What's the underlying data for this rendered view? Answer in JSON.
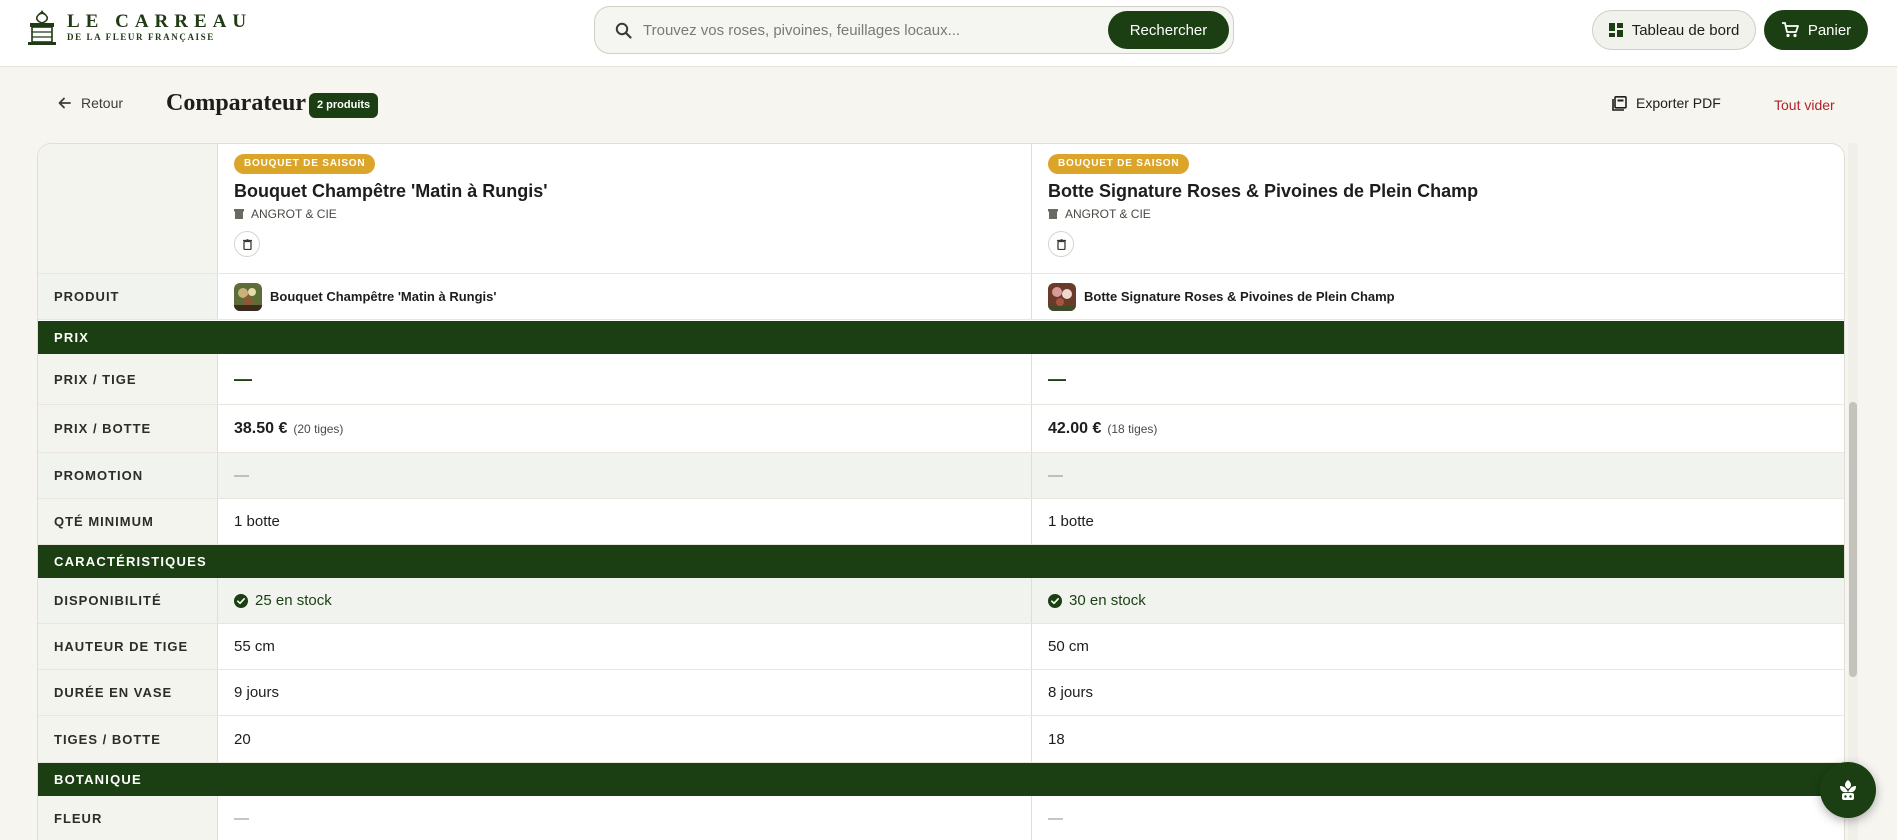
{
  "header": {
    "logo": {
      "line1": "LE CARREAU",
      "line2": "DE LA FLEUR FRANÇAISE",
      "icon": "storefront-logo-icon"
    },
    "search": {
      "placeholder": "Trouvez vos roses, pivoines, feuillages locaux...",
      "value": "",
      "button_label": "Rechercher",
      "icon": "search-icon"
    },
    "dashboard_label": "Tableau de bord",
    "cart_label": "Panier"
  },
  "toolbar": {
    "back_label": "Retour",
    "title": "Comparateur",
    "count_badge": "2 produits",
    "export_label": "Exporter PDF",
    "clear_label": "Tout vider"
  },
  "products": [
    {
      "tag": "BOUQUET DE SAISON",
      "name": "Bouquet Champêtre 'Matin à Rungis'",
      "supplier": "ANGROT & CIE"
    },
    {
      "tag": "BOUQUET DE SAISON",
      "name": "Botte Signature Roses & Pivoines de Plein Champ",
      "supplier": "ANGROT & CIE"
    }
  ],
  "rows": {
    "produit": {
      "label": "PRODUIT"
    },
    "prix_tige": {
      "label": "PRIX / TIGE",
      "values": [
        "—",
        "—"
      ]
    },
    "prix_botte": {
      "label": "PRIX / BOTTE",
      "values": [
        "38.50 €",
        "42.00 €"
      ],
      "notes": [
        "(20 tiges)",
        "(18 tiges)"
      ]
    },
    "promotion": {
      "label": "PROMOTION",
      "values": [
        "—",
        "—"
      ]
    },
    "qte_min": {
      "label": "QTÉ MINIMUM",
      "values": [
        "1 botte",
        "1 botte"
      ]
    },
    "disponibilite": {
      "label": "DISPONIBILITÉ",
      "values": [
        "25 en stock",
        "30 en stock"
      ]
    },
    "hauteur": {
      "label": "HAUTEUR DE TIGE",
      "values": [
        "55 cm",
        "50 cm"
      ]
    },
    "duree": {
      "label": "DURÉE EN VASE",
      "values": [
        "9 jours",
        "8 jours"
      ]
    },
    "tiges": {
      "label": "TIGES / BOTTE",
      "values": [
        "20",
        "18"
      ]
    },
    "fleur": {
      "label": "FLEUR",
      "values": [
        "—",
        "—"
      ]
    }
  },
  "sections": {
    "prix": "PRIX",
    "caracteristiques": "CARACTÉRISTIQUES",
    "botanique": "BOTANIQUE"
  },
  "colors": {
    "brand_green": "#1b3f12",
    "tag_gold": "#dba52a",
    "danger_red": "#b0242a"
  }
}
